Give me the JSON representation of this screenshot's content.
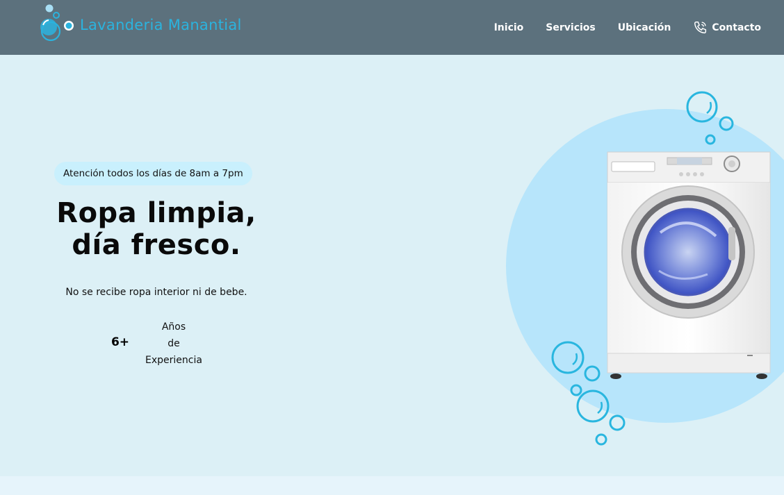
{
  "brand": {
    "name": "Lavanderia Manantial",
    "logo_icon": "bubbles-logo-icon",
    "color": "#2bb3de"
  },
  "nav": {
    "items": [
      {
        "label": "Inicio"
      },
      {
        "label": "Servicios"
      },
      {
        "label": "Ubicación"
      },
      {
        "label": "Contacto",
        "icon": "phone-icon"
      }
    ]
  },
  "hero": {
    "badge": "Atención todos los días de 8am a 7pm",
    "headline_line1": "Ropa limpia,",
    "headline_line2": "día fresco.",
    "notice": "No se recibe ropa interior ni de bebe.",
    "stat": {
      "value": "6+",
      "label_line1": "Años",
      "label_line2": "de",
      "label_line3": "Experiencia"
    },
    "image": "washing-machine"
  },
  "next_section": {
    "title": ""
  },
  "colors": {
    "header_bg": "#5c717d",
    "hero_bg": "#dcf0f6",
    "blob": "#b7e5fb",
    "bubble": "#29b6df",
    "badge_bg": "#c9f0fd"
  }
}
